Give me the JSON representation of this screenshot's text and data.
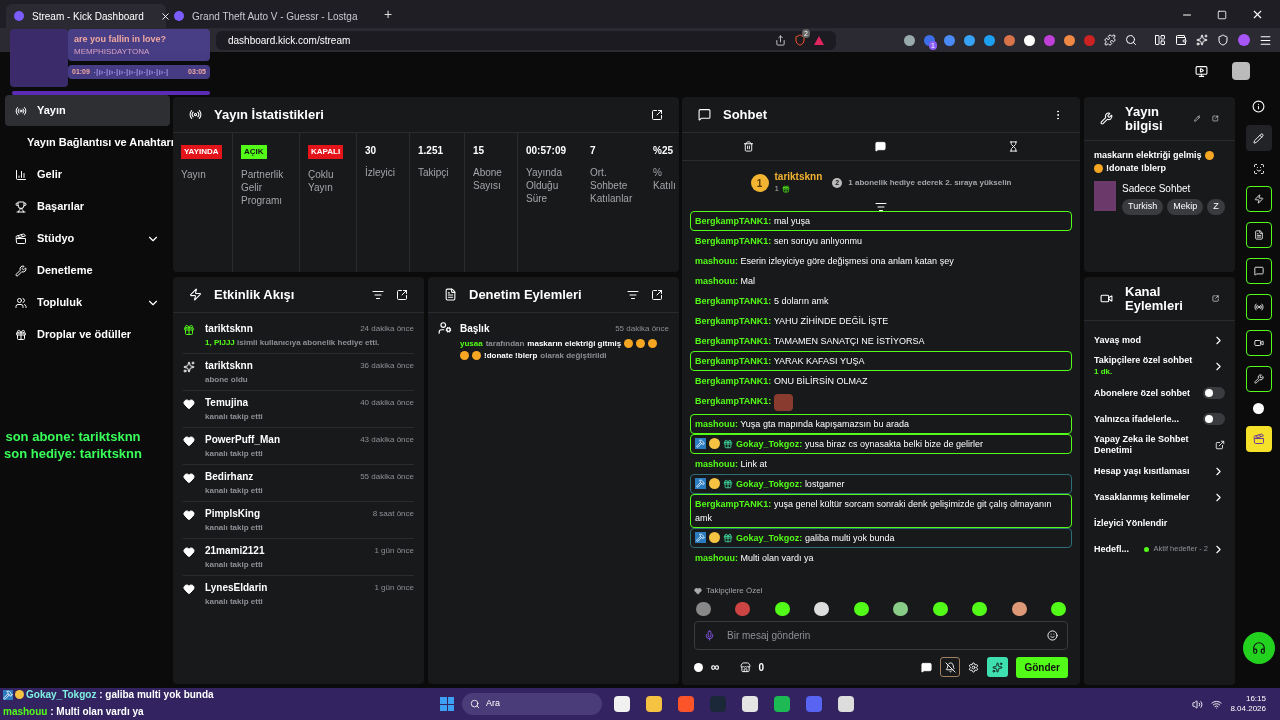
{
  "music_widget": {
    "title": "are you fallin in love?",
    "artist": "MEMPHISDAYTONA",
    "elapsed": "01:09",
    "duration": "03:05",
    "level": 1
  },
  "browser": {
    "tabs": [
      {
        "title": "Stream - Kick Dashboard",
        "selected": true
      },
      {
        "title": "Grand Theft Auto V - Guessr - Lostga",
        "selected": false
      }
    ],
    "new_tab": "+",
    "url": "dashboard.kick.com/stream",
    "shield_count": "2",
    "extension_count": "1"
  },
  "sidebar": {
    "items": [
      {
        "kind": "main",
        "label": "Yayın",
        "selected": true
      },
      {
        "kind": "sub",
        "label": "Yayın Bağlantısı ve Anahtarı",
        "selected": false
      },
      {
        "kind": "main",
        "label": "Gelir",
        "selected": false
      },
      {
        "kind": "main",
        "label": "Başarılar",
        "selected": false
      },
      {
        "kind": "main",
        "label": "Stüdyo",
        "selected": false,
        "expanded": false
      },
      {
        "kind": "main",
        "label": "Denetleme",
        "selected": false
      },
      {
        "kind": "main",
        "label": "Topluluk",
        "selected": false,
        "expanded": false
      },
      {
        "kind": "main",
        "label": "Droplar ve ödüller",
        "selected": false
      }
    ]
  },
  "overlay_lines": [
    "son abone: tariktsknn",
    "son hediye: tariktsknn"
  ],
  "stats": {
    "title": "Yayın İstatistikleri",
    "cells": [
      {
        "kind": "badge",
        "value": "YAYINDA",
        "color": "#e4141b",
        "label": "Yayın"
      },
      {
        "kind": "badge",
        "value": "AÇIK",
        "color": "#53fc18",
        "label": "Partnerlik Gelir Programı"
      },
      {
        "kind": "badge",
        "value": "KAPALI",
        "color": "#e4141b",
        "label": "Çoklu Yayın"
      },
      {
        "kind": "number",
        "value": "30",
        "label": "İzleyici"
      },
      {
        "kind": "number",
        "value": "1.251",
        "label": "Takipçi"
      },
      {
        "kind": "number",
        "value": "15",
        "label": "Abone Sayısı"
      },
      {
        "kind": "number",
        "value": "00:57:09",
        "label": "Yayında Olduğu Süre"
      },
      {
        "kind": "number",
        "value": "7",
        "label": "Ort. Sohbete Katılanlar"
      },
      {
        "kind": "number",
        "value": "%25",
        "label": "% Katılı"
      }
    ]
  },
  "events": {
    "title": "Etkinlik Akışı",
    "items": [
      {
        "kind": "gift",
        "name": "tariktsknn",
        "time": "24 dakika önce",
        "highlight": "1, PIJJJ",
        "detail": "isimli kullanıcıya abonelik hediye etti."
      },
      {
        "kind": "subscribe",
        "name": "tariktsknn",
        "time": "36 dakika önce",
        "detail": "abone oldu"
      },
      {
        "kind": "follow",
        "name": "Temujina",
        "time": "40 dakika önce",
        "detail": "kanalı takip etti"
      },
      {
        "kind": "follow",
        "name": "PowerPuff_Man",
        "time": "43 dakika önce",
        "detail": "kanalı takip etti"
      },
      {
        "kind": "follow",
        "name": "Bedirhanz",
        "time": "55 dakika önce",
        "detail": "kanalı takip etti"
      },
      {
        "kind": "follow",
        "name": "PimplsKing",
        "time": "8 saat önce",
        "detail": "kanalı takip etti"
      },
      {
        "kind": "follow",
        "name": "21mami2121",
        "time": "1 gün önce",
        "detail": "kanalı takip etti"
      },
      {
        "kind": "follow",
        "name": "LynesEldarin",
        "time": "1 gün önce",
        "detail": "kanalı takip etti"
      }
    ]
  },
  "moderation": {
    "title": "Denetim Eylemleri",
    "items": [
      {
        "heading": "Başlık",
        "time": "55 dakika önce",
        "user": "yusaa",
        "by": "tarafından",
        "new_title": "maskarın elektriği gitmiş",
        "tail": "!donate !blerp",
        "suffix": "olarak değiştirildi"
      }
    ]
  },
  "chat": {
    "title": "Sohbet",
    "leader": {
      "rank": "1",
      "name": "tariktsknn",
      "gifts": "1",
      "next_rank": "2",
      "hint": "1 abonelik hediye ederek 2. sıraya yükselin"
    },
    "messages": [
      {
        "user": "BergkampTANK1:",
        "text": "mal yuşa",
        "highlighted": true,
        "mentioned": false,
        "badged": false
      },
      {
        "user": "BergkampTANK1:",
        "text": "sen soruyu anlıyonmu",
        "highlighted": false,
        "mentioned": false,
        "badged": false
      },
      {
        "user": "mashouu:",
        "text": "Eserin izleyiciye göre değişmesi ona anlam katan şey",
        "highlighted": false,
        "mentioned": false,
        "badged": false
      },
      {
        "user": "mashouu:",
        "text": "Mal",
        "highlighted": false,
        "mentioned": false,
        "badged": false
      },
      {
        "user": "BergkampTANK1:",
        "text": "5 doların amk",
        "highlighted": false,
        "mentioned": false,
        "badged": false
      },
      {
        "user": "BergkampTANK1:",
        "text": "YAHU ZİHİNDE DEĞİL İŞTE",
        "highlighted": false,
        "mentioned": false,
        "badged": false
      },
      {
        "user": "BergkampTANK1:",
        "text": "TAMAMEN SANATÇI NE İSTİYORSA",
        "highlighted": false,
        "mentioned": false,
        "badged": false
      },
      {
        "user": "BergkampTANK1:",
        "text": "YARAK KAFASI YUŞA",
        "highlighted": true,
        "mentioned": false,
        "badged": false
      },
      {
        "user": "BergkampTANK1:",
        "text": "ONU BİLİRSİN OLMAZ",
        "highlighted": false,
        "mentioned": false,
        "badged": false
      },
      {
        "user": "BergkampTANK1:",
        "highlighted": false,
        "mentioned": false,
        "badged": false,
        "emote": true
      },
      {
        "user": "mashouu:",
        "text": "Yuşa gta mapında kapışamazsın bu arada",
        "highlighted": true,
        "mentioned": false,
        "badged": false
      },
      {
        "user": "Gokay_Tokgoz:",
        "text": "yusa biraz cs oynasakta belki bize de gelirler",
        "highlighted": true,
        "mentioned": false,
        "badged": true
      },
      {
        "user": "mashouu:",
        "text": "Link at",
        "highlighted": false,
        "mentioned": false,
        "badged": false
      },
      {
        "user": "Gokay_Tokgoz:",
        "text": "lostgamer",
        "highlighted": false,
        "mentioned": true,
        "badged": true
      },
      {
        "user": "BergkampTANK1:",
        "text": "yuşa genel kültür sorcam sonraki denk gelişimizde git çalış olmayanın amk",
        "highlighted": true,
        "mentioned": false,
        "badged": false
      },
      {
        "user": "Gokay_Tokgoz:",
        "text": "galiba multi yok bunda",
        "highlighted": false,
        "mentioned": true,
        "badged": true
      },
      {
        "user": "mashouu:",
        "text": "Multi olan vardı ya",
        "highlighted": false,
        "mentioned": false,
        "badged": false
      }
    ],
    "emote_label": "Takipçilere Özel",
    "placeholder": "Bir mesaj gönderin",
    "points": "∞",
    "store_count": "0",
    "send": "Gönder"
  },
  "stream_info": {
    "title": "Yayın bilgisi",
    "stream_title": "maskarın elektriği gelmiş",
    "stream_title_tail": "!donate !blerp",
    "category": "Sadece Sohbet",
    "tags": [
      "Turkish",
      "Mekip",
      "Z"
    ]
  },
  "channel_actions": {
    "title": "Kanal Eylemleri",
    "items": [
      {
        "kind": "link",
        "label": "Yavaş mod"
      },
      {
        "kind": "link",
        "label": "Takipçilere özel sohbet",
        "note": "1 dk."
      },
      {
        "kind": "toggle",
        "label": "Abonelere özel sohbet",
        "on": false
      },
      {
        "kind": "toggle",
        "label": "Yalnızca ifadelerle...",
        "on": false
      },
      {
        "kind": "external",
        "label": "Yapay Zeka ile Sohbet Denetimi"
      },
      {
        "kind": "link",
        "label": "Hesap yaşı kısıtlaması"
      },
      {
        "kind": "link",
        "label": "Yasaklanmış kelimeler"
      },
      {
        "kind": "plain",
        "label": "İzleyici Yönlendir"
      },
      {
        "kind": "status",
        "label": "Hedefl...",
        "note": "Aktif hedefler - 2"
      }
    ]
  },
  "overlay_chat": [
    {
      "user": "Gokay_Tokgoz",
      "text": ": galiba multi yok bunda"
    },
    {
      "user": "mashouu",
      "text": ": Multi olan vardı ya"
    }
  ],
  "taskbar": {
    "search": "Ara",
    "time": "16:15",
    "date": "8.04.2026"
  }
}
